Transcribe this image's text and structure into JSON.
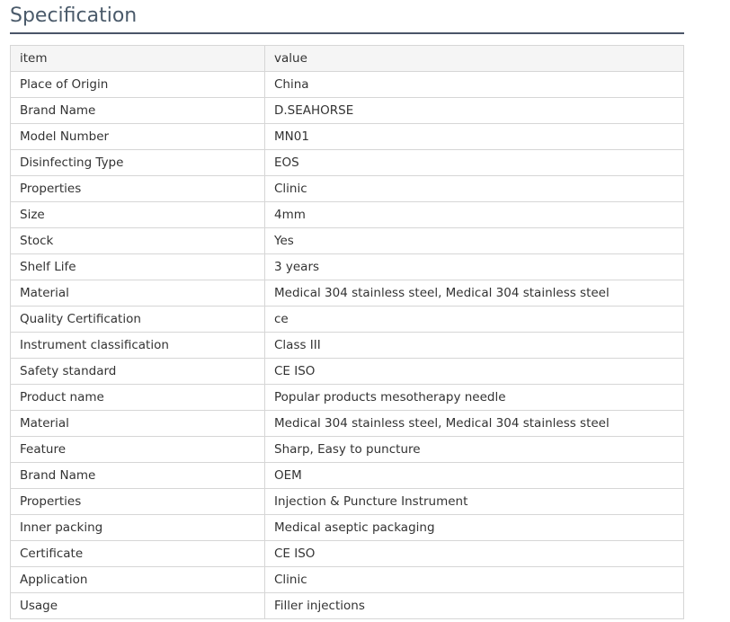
{
  "section": {
    "title": "Specification"
  },
  "table": {
    "header": {
      "item": "item",
      "value": "value"
    },
    "rows": [
      {
        "item": "Place of Origin",
        "value": "China"
      },
      {
        "item": "Brand Name",
        "value": "D.SEAHORSE"
      },
      {
        "item": "Model Number",
        "value": "MN01"
      },
      {
        "item": "Disinfecting Type",
        "value": "EOS"
      },
      {
        "item": "Properties",
        "value": "Clinic"
      },
      {
        "item": "Size",
        "value": "4mm"
      },
      {
        "item": "Stock",
        "value": "Yes"
      },
      {
        "item": "Shelf Life",
        "value": "3 years"
      },
      {
        "item": "Material",
        "value": "Medical 304 stainless steel, Medical 304 stainless steel"
      },
      {
        "item": "Quality Certification",
        "value": "ce"
      },
      {
        "item": "Instrument classification",
        "value": "Class III"
      },
      {
        "item": "Safety standard",
        "value": "CE ISO"
      },
      {
        "item": "Product name",
        "value": "Popular products mesotherapy needle"
      },
      {
        "item": "Material",
        "value": "Medical 304 stainless steel, Medical 304 stainless steel"
      },
      {
        "item": "Feature",
        "value": "Sharp, Easy to puncture"
      },
      {
        "item": "Brand Name",
        "value": "OEM"
      },
      {
        "item": "Properties",
        "value": "Injection & Puncture Instrument"
      },
      {
        "item": "Inner packing",
        "value": "Medical aseptic packaging"
      },
      {
        "item": "Certificate",
        "value": "CE ISO"
      },
      {
        "item": "Application",
        "value": "Clinic"
      },
      {
        "item": "Usage",
        "value": "Filler injections"
      }
    ]
  }
}
